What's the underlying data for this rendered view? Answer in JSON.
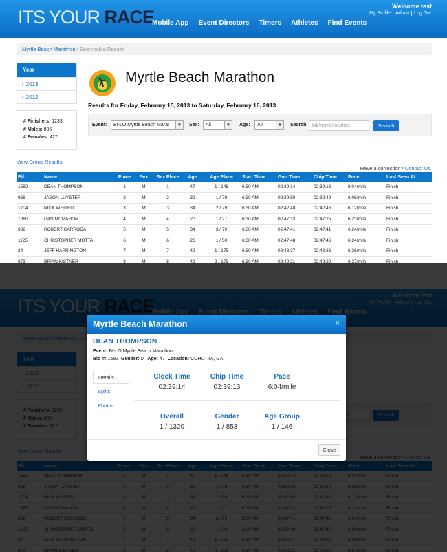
{
  "site": {
    "logo_part1": "ITS YOUR ",
    "logo_part2": "RACE",
    "nav": [
      "Mobile App",
      "Event Directors",
      "Timers",
      "Athletes",
      "Find Events"
    ],
    "welcome": "Welcome test",
    "user_links": [
      "My Profile",
      "Admin",
      "Log Out"
    ]
  },
  "breadcrumb": {
    "link": "Myrtle Beach Marathon",
    "sep": "/",
    "current": "Searchable Results"
  },
  "sidebar": {
    "year_header": "Year",
    "years": [
      "2013",
      "2012"
    ],
    "stats": [
      {
        "label": "# Finishers:",
        "value": "1233"
      },
      {
        "label": "# Males:",
        "value": "806"
      },
      {
        "label": "# Females:",
        "value": "427"
      }
    ],
    "view_group_results": "View Group Results"
  },
  "event": {
    "title": "Myrtle Beach Marathon",
    "results_for": "Results for Friday, February 15, 2013 to Saturday, February 16, 2013"
  },
  "filters": {
    "event_label": "Event:",
    "event_value": "BI-LO Myrtle Beach Marat",
    "sex_label": "Sex:",
    "sex_value": "All",
    "age_label": "Age:",
    "age_value": "All",
    "search_label": "Search:",
    "search_placeholder": "bib/name/location",
    "search_button": "Search"
  },
  "correction": {
    "text": "Have a correction?",
    "link": "Contact Us."
  },
  "table": {
    "headers": [
      "Bib",
      "Name",
      "Place",
      "Sex",
      "Sex Place",
      "Age",
      "Age Place",
      "Start Time",
      "Gun Time",
      "Chip Time",
      "Pace",
      "Last Seen At"
    ],
    "rows": [
      [
        "1582",
        "DEAN THOMPSON",
        "1",
        "M",
        "1",
        "47",
        "1 / 146",
        "6:30 AM",
        "02:39:14",
        "02:39:13",
        "6:04/mile",
        "Finish"
      ],
      [
        "968",
        "JASON LUYSTER",
        "2",
        "M",
        "2",
        "32",
        "1 / 79",
        "6:30 AM",
        "02:39:50",
        "02:39:49",
        "6:06/mile",
        "Finish"
      ],
      [
        "1704",
        "NICK WHITED",
        "3",
        "M",
        "3",
        "34",
        "2 / 79",
        "6:30 AM",
        "02:42:48",
        "02:42:46",
        "6:12/mile",
        "Finish"
      ],
      [
        "1060",
        "DAN MCMAHON",
        "4",
        "M",
        "4",
        "20",
        "1 / 27",
        "6:30 AM",
        "02:47:33",
        "02:47:25",
        "6:23/mile",
        "Finish"
      ],
      [
        "302",
        "ROBERT CARROCA",
        "5",
        "M",
        "5",
        "34",
        "3 / 79",
        "6:30 AM",
        "02:47:41",
        "02:47:41",
        "6:24/mile",
        "Finish"
      ],
      [
        "1125",
        "CHRISTOPHER MOTTA",
        "6",
        "M",
        "6",
        "26",
        "1 / 50",
        "6:30 AM",
        "02:47:48",
        "02:47:46",
        "6:24/mile",
        "Finish"
      ],
      [
        "24",
        "JEFF HARRINGTON",
        "7",
        "M",
        "7",
        "42",
        "1 / 175",
        "6:30 AM",
        "02:48:37",
        "02:48:36",
        "6:26/mile",
        "Finish"
      ],
      [
        "873",
        "BRIAN KISTNER",
        "8",
        "M",
        "8",
        "42",
        "2 / 175",
        "6:30 AM",
        "02:49:21",
        "02:49:20",
        "6:27/mile",
        "Finish"
      ]
    ]
  },
  "modal": {
    "title": "Myrtle Beach Marathon",
    "close_x": "×",
    "athlete_name": "DEAN THOMPSON",
    "event_label": "Event:",
    "event_value": "BI-LO Myrtle Beach Marathon",
    "bib_label": "Bib #:",
    "bib_value": "1582",
    "gender_label": "Gender:",
    "gender_value": "M",
    "age_label": "Age:",
    "age_value": "47",
    "location_label": "Location:",
    "location_value": "COHUTTA, GA",
    "tabs": [
      "Details",
      "Splits",
      "Photos"
    ],
    "clock_time_label": "Clock Time",
    "clock_time": "02:39:14",
    "chip_time_label": "Chip Time",
    "chip_time": "02:39:13",
    "pace_label": "Pace",
    "pace": "6:04/mile",
    "overall_label": "Overall",
    "overall": "1 / 1320",
    "gender_rank_label": "Gender",
    "gender_rank": "1 / 853",
    "age_group_label": "Age Group",
    "age_group": "1 / 146",
    "close_button": "Close"
  }
}
